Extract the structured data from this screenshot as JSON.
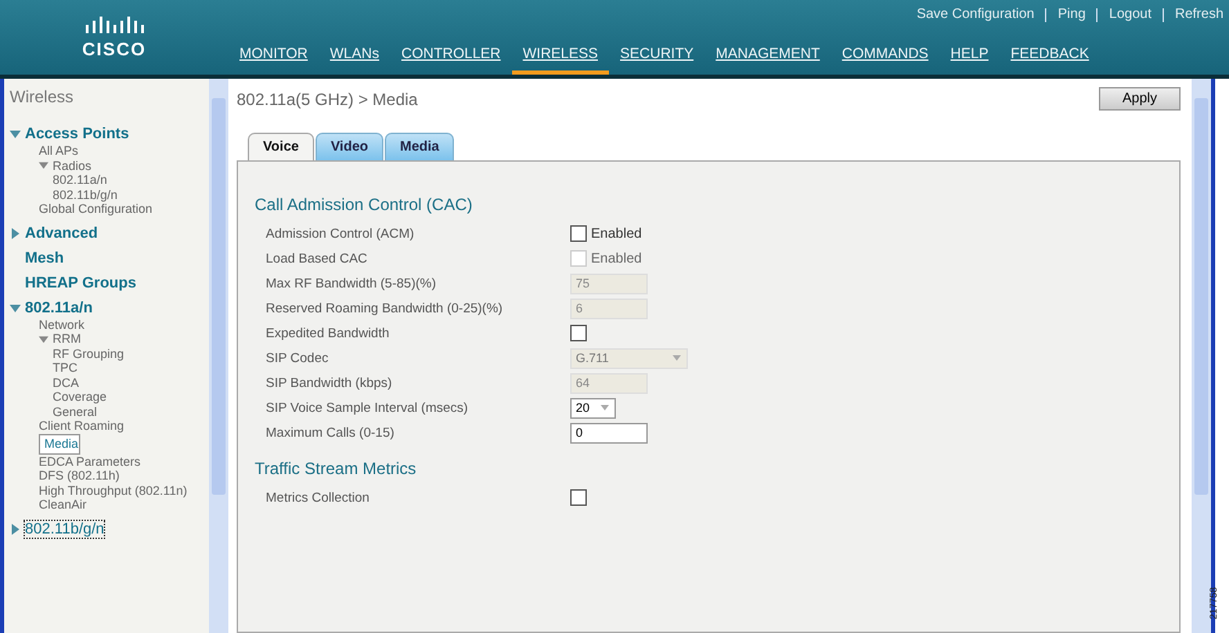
{
  "header": {
    "logo": "CISCO",
    "top_links": [
      "Save Configuration",
      "Ping",
      "Logout",
      "Refresh"
    ],
    "nav": [
      {
        "label": "MONITOR",
        "selected": false
      },
      {
        "label": "WLANs",
        "selected": false
      },
      {
        "label": "CONTROLLER",
        "selected": false
      },
      {
        "label": "WIRELESS",
        "selected": true
      },
      {
        "label": "SECURITY",
        "selected": false
      },
      {
        "label": "MANAGEMENT",
        "selected": false
      },
      {
        "label": "COMMANDS",
        "selected": false
      },
      {
        "label": "HELP",
        "selected": false
      },
      {
        "label": "FEEDBACK",
        "selected": false
      }
    ]
  },
  "sidebar": {
    "title": "Wireless",
    "items": [
      {
        "label": "Access Points",
        "kind": "section",
        "expanded": true,
        "children": [
          {
            "label": "All APs",
            "selected": false
          },
          {
            "label": "Radios",
            "expanded": true,
            "children": [
              {
                "label": "802.11a/n",
                "selected": false
              },
              {
                "label": "802.11b/g/n",
                "selected": false
              }
            ]
          },
          {
            "label": "Global Configuration",
            "selected": false
          }
        ]
      },
      {
        "label": "Advanced",
        "kind": "section",
        "expanded": false
      },
      {
        "label": "Mesh",
        "kind": "section"
      },
      {
        "label": "HREAP Groups",
        "kind": "section"
      },
      {
        "label": "802.11a/n",
        "kind": "section",
        "expanded": true,
        "children": [
          {
            "label": "Network",
            "selected": false
          },
          {
            "label": "RRM",
            "expanded": true,
            "children": [
              {
                "label": "RF Grouping",
                "selected": false
              },
              {
                "label": "TPC",
                "selected": false
              },
              {
                "label": "DCA",
                "selected": false
              },
              {
                "label": "Coverage",
                "selected": false
              },
              {
                "label": "General",
                "selected": false
              }
            ]
          },
          {
            "label": "Client Roaming",
            "selected": false
          },
          {
            "label": "Media",
            "selected": true
          },
          {
            "label": "EDCA Parameters",
            "selected": false
          },
          {
            "label": "DFS (802.11h)",
            "selected": false
          },
          {
            "label": "High Throughput (802.11n)",
            "selected": false
          },
          {
            "label": "CleanAir",
            "selected": false
          }
        ]
      },
      {
        "label": "802.11b/g/n",
        "kind": "section",
        "expanded": false,
        "focused": true
      }
    ]
  },
  "page": {
    "title": "802.11a(5 GHz) > Media",
    "apply": "Apply",
    "tabs": [
      {
        "label": "Voice",
        "selected": true
      },
      {
        "label": "Video",
        "selected": false
      },
      {
        "label": "Media",
        "selected": false
      }
    ],
    "sections": [
      {
        "title": "Call Admission Control (CAC)",
        "rows": [
          {
            "label": "Admission Control (ACM)",
            "kind": "checkbox",
            "checked": false,
            "disabled": false,
            "caption": "Enabled"
          },
          {
            "label": "Load Based CAC",
            "kind": "checkbox",
            "checked": false,
            "disabled": true,
            "caption": "Enabled"
          },
          {
            "label": "Max RF Bandwidth (5-85)(%)",
            "kind": "text",
            "value": "75",
            "disabled": true
          },
          {
            "label": "Reserved Roaming Bandwidth (0-25)(%)",
            "kind": "text",
            "value": "6",
            "disabled": true
          },
          {
            "label": "Expedited Bandwidth",
            "kind": "checkbox",
            "checked": false,
            "disabled": false
          },
          {
            "label": "SIP Codec",
            "kind": "select",
            "value": "G.711",
            "disabled": true
          },
          {
            "label": "SIP Bandwidth (kbps)",
            "kind": "text",
            "value": "64",
            "disabled": true
          },
          {
            "label": "SIP Voice Sample Interval (msecs)",
            "kind": "select",
            "value": "20",
            "disabled": false
          },
          {
            "label": "Maximum Calls (0-15)",
            "kind": "text",
            "value": "0",
            "disabled": false
          }
        ]
      },
      {
        "title": "Traffic Stream Metrics",
        "rows": [
          {
            "label": "Metrics Collection",
            "kind": "checkbox",
            "checked": false,
            "disabled": false
          }
        ]
      }
    ]
  },
  "figure_id": "217758"
}
